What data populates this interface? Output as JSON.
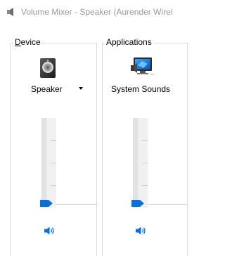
{
  "window": {
    "title": "Volume Mixer - Speaker (Aurender Wirel",
    "title_icon": "speaker-icon"
  },
  "device": {
    "group_label": "Device",
    "name": "Speaker",
    "icon": "speaker-device-icon",
    "volume_percent": 0
  },
  "applications": {
    "group_label": "Applications",
    "items": [
      {
        "name": "System Sounds",
        "icon": "system-sounds-monitor-icon",
        "volume_percent": 0
      }
    ]
  },
  "colors": {
    "accent": "#0a6fd8",
    "title_text": "#9a9a9a",
    "track": "#eeeeee"
  }
}
